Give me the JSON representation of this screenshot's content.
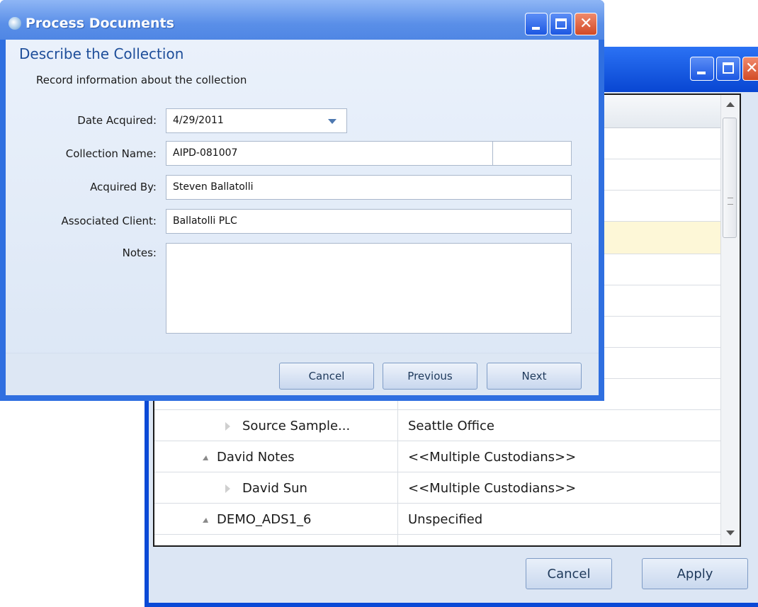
{
  "dialog": {
    "title": "Process Documents",
    "heading": "Describe the Collection",
    "subtext": "Record information about the collection",
    "fields": {
      "date_label": "Date Acquired:",
      "date_value": "4/29/2011",
      "collection_label": "Collection Name:",
      "collection_value": "AIPD-081007",
      "acquired_label": "Acquired By:",
      "acquired_value": "Steven Ballatolli",
      "client_label": "Associated Client:",
      "client_value": "Ballatolli PLC",
      "notes_label": "Notes:",
      "notes_value": ""
    },
    "buttons": {
      "cancel": "Cancel",
      "previous": "Previous",
      "next": "Next"
    }
  },
  "background_window": {
    "rows": [
      {
        "name": "Source Sample...",
        "value": "Seattle Office",
        "expanded": false
      },
      {
        "name": "David Notes",
        "value": "<<Multiple Custodians>>",
        "expanded": true
      },
      {
        "name": "David Sun",
        "value": "<<Multiple Custodians>>",
        "expanded": false
      },
      {
        "name": "DEMO_ADS1_6",
        "value": "Unspecified",
        "expanded": true
      }
    ],
    "buttons": {
      "cancel": "Cancel",
      "apply": "Apply"
    }
  },
  "colors": {
    "titlebar": "#2f6fe0",
    "accent": "#1e4e9a",
    "highlight_row": "#fdf7d7",
    "close_button": "#d24a26"
  },
  "icons": [
    "app-icon",
    "minimize-icon",
    "maximize-icon",
    "close-icon",
    "chevron-down-icon",
    "expand-triangle-icon",
    "collapse-triangle-icon"
  ]
}
